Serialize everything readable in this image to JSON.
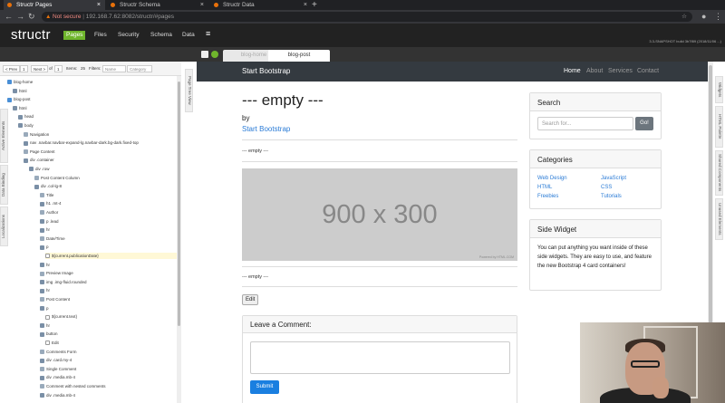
{
  "browser": {
    "tabs": [
      {
        "title": "Structr Pages",
        "active": true
      },
      {
        "title": "Structr Schema",
        "active": false
      },
      {
        "title": "Structr Data",
        "active": false
      }
    ],
    "url_warning": "Not secure",
    "url": "192.168.7.62:8082/structr/#pages"
  },
  "app": {
    "logo": "structr",
    "menu": [
      "Pages",
      "Files",
      "Security",
      "Schema",
      "Data"
    ],
    "active_menu": "Pages",
    "version": "3.3-SNAPSHOT build 3b7f89 (2018/11/06 ...)"
  },
  "page_tabs": [
    "blog-home",
    "blog-post"
  ],
  "active_page_tab": "blog-post",
  "pager": {
    "prev": "< Prev",
    "page": "1",
    "next": "Next >",
    "of": "of",
    "total": "1",
    "items_label": "Items:",
    "items": "25",
    "filters_label": "Filters:",
    "name_placeholder": "Name",
    "category_placeholder": "Category"
  },
  "tree": [
    {
      "text": "blog-home",
      "indent": 0,
      "icon": "page-icon"
    },
    {
      "text": "html",
      "indent": 1,
      "icon": "element-icon"
    },
    {
      "text": "blog-post",
      "indent": 0,
      "icon": "page-icon"
    },
    {
      "text": "html",
      "indent": 1,
      "icon": "element-icon"
    },
    {
      "text": "head",
      "indent": 2,
      "icon": "element-icon"
    },
    {
      "text": "body",
      "indent": 2,
      "icon": "element-icon"
    },
    {
      "text": "Navigation",
      "indent": 3,
      "icon": "comment-icon"
    },
    {
      "text": "nav .navbar.navbar-expand-lg.navbar-dark.bg-dark.fixed-top",
      "indent": 3,
      "icon": "element-icon"
    },
    {
      "text": "Page Content",
      "indent": 3,
      "icon": "comment-icon"
    },
    {
      "text": "div .container",
      "indent": 3,
      "icon": "element-icon"
    },
    {
      "text": "div .row",
      "indent": 4,
      "icon": "element-icon"
    },
    {
      "text": "Post Content Column",
      "indent": 5,
      "icon": "comment-icon"
    },
    {
      "text": "div .col-lg-8",
      "indent": 5,
      "icon": "element-icon"
    },
    {
      "text": "Title",
      "indent": 6,
      "icon": "comment-icon"
    },
    {
      "text": "h1 .mt-4",
      "indent": 6,
      "icon": "element-icon"
    },
    {
      "text": "Author",
      "indent": 6,
      "icon": "comment-icon"
    },
    {
      "text": "p .lead",
      "indent": 6,
      "icon": "element-icon"
    },
    {
      "text": "hr",
      "indent": 6,
      "icon": "element-icon"
    },
    {
      "text": "Date/Time",
      "indent": 6,
      "icon": "comment-icon"
    },
    {
      "text": "p",
      "indent": 6,
      "icon": "element-icon"
    },
    {
      "text": "${current.publicationDate}",
      "indent": 7,
      "icon": "content-icon",
      "highlight": true
    },
    {
      "text": "hr",
      "indent": 6,
      "icon": "element-icon"
    },
    {
      "text": "Preview Image",
      "indent": 6,
      "icon": "comment-icon"
    },
    {
      "text": "img .img-fluid.rounded",
      "indent": 6,
      "icon": "element-icon"
    },
    {
      "text": "hr",
      "indent": 6,
      "icon": "element-icon"
    },
    {
      "text": "Post Content",
      "indent": 6,
      "icon": "comment-icon"
    },
    {
      "text": "p",
      "indent": 6,
      "icon": "element-icon"
    },
    {
      "text": "${current.text}",
      "indent": 7,
      "icon": "content-icon"
    },
    {
      "text": "hr",
      "indent": 6,
      "icon": "element-icon"
    },
    {
      "text": "button",
      "indent": 6,
      "icon": "element-icon"
    },
    {
      "text": "Edit",
      "indent": 7,
      "icon": "content-icon"
    },
    {
      "text": "Comments Form",
      "indent": 6,
      "icon": "comment-icon"
    },
    {
      "text": "div .card.my-4",
      "indent": 6,
      "icon": "element-icon"
    },
    {
      "text": "Single Comment",
      "indent": 6,
      "icon": "comment-icon"
    },
    {
      "text": "div .media.mb-4",
      "indent": 6,
      "icon": "element-icon"
    },
    {
      "text": "Comment with nested comments",
      "indent": 6,
      "icon": "comment-icon"
    },
    {
      "text": "div .media.mb-4",
      "indent": 6,
      "icon": "element-icon"
    }
  ],
  "left_vtabs": [
    "Active Elements",
    "Data Binding",
    "Localizations"
  ],
  "tree_view_label": "Page Tree View",
  "right_vtabs": [
    "Widgets",
    "HTML Palette",
    "Shared Components",
    "Unused Elements"
  ],
  "preview": {
    "brand": "Start Bootstrap",
    "nav": [
      "Home",
      "About",
      "Services",
      "Contact"
    ],
    "title": "--- empty ---",
    "by": "by",
    "author": "Start Bootstrap",
    "date": "--- empty ---",
    "image_text": "900 x 300",
    "image_caption": "Powered by HTML.COM",
    "content": "--- empty ---",
    "edit_button": "Edit",
    "comment_header": "Leave a Comment:",
    "submit_button": "Submit",
    "search_header": "Search",
    "search_placeholder": "Search for...",
    "go_button": "Go!",
    "categories_header": "Categories",
    "categories": [
      "Web Design",
      "HTML",
      "Freebies",
      "JavaScript",
      "CSS",
      "Tutorials"
    ],
    "side_header": "Side Widget",
    "side_text": "You can put anything you want inside of these side widgets. They are easy to use, and feature the new Bootstrap 4 card containers!"
  },
  "colors": {
    "accent": "#6fb52c",
    "link": "#2a7bd6",
    "navbar": "#343a40",
    "primary": "#1a7fe0"
  }
}
